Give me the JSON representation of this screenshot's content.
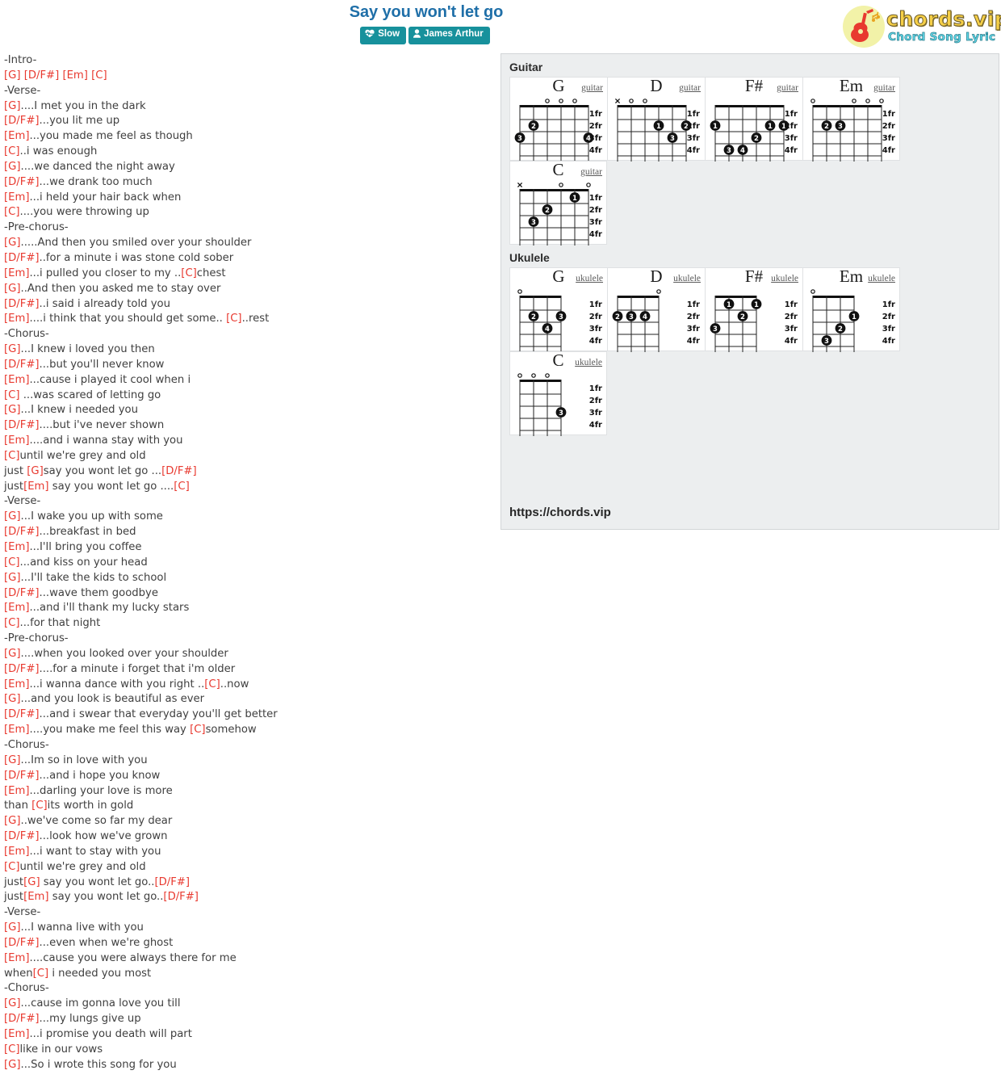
{
  "header": {
    "title": "Say you won't let go",
    "badges": [
      {
        "icon": "heartbeat-icon",
        "label": "Slow"
      },
      {
        "icon": "user-icon",
        "label": "James Arthur"
      }
    ],
    "logo": {
      "main": "chords.vip",
      "sub": "Chord Song Lyric",
      "icon": "guitar-icon"
    }
  },
  "lyrics": "-Intro-\n[G] [D/F#] [Em] [C]\n-Verse-\n[G]....I met you in the dark\n[D/F#]...you lit me up\n[Em]...you made me feel as though\n[C]..i was enough\n[G]....we danced the night away\n[D/F#]...we drank too much\n[Em]...i held your hair back when\n[C]....you were throwing up\n-Pre-chorus-\n[G].....And then you smiled over your shoulder\n[D/F#]..for a minute i was stone cold sober\n[Em]...i pulled you closer to my ..[C]chest\n[G]..And then you asked me to stay over\n[D/F#]..i said i already told you\n[Em]....i think that you should get some.. [C]..rest\n-Chorus-\n[G]...I knew i loved you then\n[D/F#]...but you'll never know\n[Em]...cause i played it cool when i\n[C] ...was scared of letting go\n[G]...I knew i needed you\n[D/F#]....but i've never shown\n[Em]....and i wanna stay with you\n[C]until we're grey and old\njust [G]say you wont let go ...[D/F#]\njust[Em] say you wont let go ....[C]\n-Verse-\n[G]...I wake you up with some\n[D/F#]...breakfast in bed\n[Em]...I'll bring you coffee\n[C]...and kiss on your head\n[G]...I'll take the kids to school\n[D/F#]...wave them goodbye\n[Em]...and i'll thank my lucky stars\n[C]...for that night\n-Pre-chorus-\n[G]....when you looked over your shoulder\n[D/F#]....for a minute i forget that i'm older\n[Em]...i wanna dance with you right ..[C]..now\n[G]...and you look is beautiful as ever\n[D/F#]...and i swear that everyday you'll get better\n[Em]....you make me feel this way [C]somehow\n-Chorus-\n[G]...Im so in love with you\n[D/F#]...and i hope you know\n[Em]...darling your love is more\nthan [C]its worth in gold\n[G]..we've come so far my dear\n[D/F#]...look how we've grown\n[Em]...i want to stay with you\n[C]until we're grey and old\njust[G] say you wont let go..[D/F#]\njust[Em] say you wont let go..[D/F#]\n-Verse-\n[G]...I wanna live with you\n[D/F#]...even when we're ghost\n[Em]....cause you were always there for me\nwhen[C] i needed you most\n-Chorus-\n[G]...cause im gonna love you till\n[D/F#]...my lungs give up\n[Em]...i promise you death will part\n[C]like in our vows\n[G]...So i wrote this song for you",
  "panel": {
    "sections": [
      {
        "label": "Guitar",
        "instrument": "guitar",
        "strings": 6,
        "frets": [
          "1fr",
          "2fr",
          "3fr",
          "4fr"
        ],
        "chords": [
          {
            "name": "G",
            "open": [
              2,
              3,
              4
            ],
            "muted": [],
            "dots": [
              {
                "string": 5,
                "fret": 2,
                "finger": "2"
              },
              {
                "string": 6,
                "fret": 3,
                "finger": "3"
              },
              {
                "string": 1,
                "fret": 3,
                "finger": "4"
              }
            ]
          },
          {
            "name": "D",
            "open": [
              4,
              5
            ],
            "muted": [
              6
            ],
            "dots": [
              {
                "string": 3,
                "fret": 2,
                "finger": "1"
              },
              {
                "string": 1,
                "fret": 2,
                "finger": "2"
              },
              {
                "string": 2,
                "fret": 3,
                "finger": "3"
              }
            ]
          },
          {
            "name": "F#",
            "open": [],
            "muted": [],
            "dots": [
              {
                "string": 6,
                "fret": 2,
                "finger": "1"
              },
              {
                "string": 2,
                "fret": 2,
                "finger": "1"
              },
              {
                "string": 1,
                "fret": 2,
                "finger": "1"
              },
              {
                "string": 3,
                "fret": 3,
                "finger": "2"
              },
              {
                "string": 5,
                "fret": 4,
                "finger": "3"
              },
              {
                "string": 4,
                "fret": 4,
                "finger": "4"
              }
            ]
          },
          {
            "name": "Em",
            "open": [
              1,
              2,
              3,
              6
            ],
            "muted": [],
            "dots": [
              {
                "string": 5,
                "fret": 2,
                "finger": "2"
              },
              {
                "string": 4,
                "fret": 2,
                "finger": "3"
              }
            ]
          },
          {
            "name": "C",
            "open": [
              1,
              3
            ],
            "muted": [
              6
            ],
            "dots": [
              {
                "string": 2,
                "fret": 1,
                "finger": "1"
              },
              {
                "string": 4,
                "fret": 2,
                "finger": "2"
              },
              {
                "string": 5,
                "fret": 3,
                "finger": "3"
              }
            ]
          }
        ]
      },
      {
        "label": "Ukulele",
        "instrument": "ukulele",
        "strings": 4,
        "frets": [
          "1fr",
          "2fr",
          "3fr",
          "4fr"
        ],
        "chords": [
          {
            "name": "G",
            "open": [
              4
            ],
            "muted": [],
            "dots": [
              {
                "string": 3,
                "fret": 2,
                "finger": "2"
              },
              {
                "string": 1,
                "fret": 2,
                "finger": "3"
              },
              {
                "string": 2,
                "fret": 3,
                "finger": "4"
              }
            ]
          },
          {
            "name": "D",
            "open": [
              1
            ],
            "muted": [],
            "dots": [
              {
                "string": 4,
                "fret": 2,
                "finger": "2"
              },
              {
                "string": 3,
                "fret": 2,
                "finger": "3"
              },
              {
                "string": 2,
                "fret": 2,
                "finger": "4"
              }
            ]
          },
          {
            "name": "F#",
            "open": [],
            "muted": [],
            "dots": [
              {
                "string": 3,
                "fret": 1,
                "finger": "1"
              },
              {
                "string": 1,
                "fret": 1,
                "finger": "1"
              },
              {
                "string": 2,
                "fret": 2,
                "finger": "2"
              },
              {
                "string": 4,
                "fret": 3,
                "finger": "3"
              }
            ]
          },
          {
            "name": "Em",
            "open": [
              4
            ],
            "muted": [],
            "dots": [
              {
                "string": 1,
                "fret": 2,
                "finger": "1"
              },
              {
                "string": 2,
                "fret": 3,
                "finger": "2"
              },
              {
                "string": 3,
                "fret": 4,
                "finger": "3"
              }
            ]
          },
          {
            "name": "C",
            "open": [
              2,
              3,
              4
            ],
            "muted": [],
            "dots": [
              {
                "string": 1,
                "fret": 3,
                "finger": "3"
              }
            ]
          }
        ]
      }
    ],
    "url": "https://chords.vip"
  },
  "colors": {
    "title": "#1f6fa8",
    "badge": "#17919c",
    "chord": "#e8392f",
    "panel_bg": "#eceeef"
  }
}
